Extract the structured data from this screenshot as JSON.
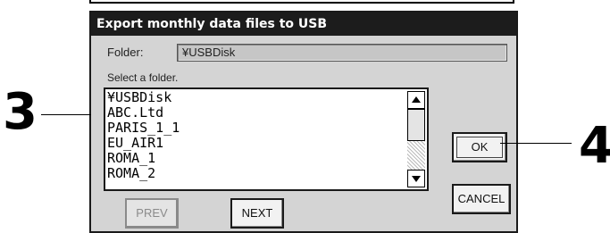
{
  "dialog": {
    "title": "Export monthly data files to USB",
    "folder_label": "Folder:",
    "folder_value": "¥USBDisk",
    "select_label": "Select a folder.",
    "folder_list": [
      "¥USBDisk",
      "ABC.Ltd",
      "PARIS_1_1",
      "EU_AIR1",
      "ROMA_1",
      "ROMA_2"
    ],
    "buttons": {
      "prev_label": "PREV",
      "next_label": "NEXT",
      "ok_label": "OK",
      "cancel_label": "CANCEL"
    }
  },
  "callouts": {
    "list_number": "3",
    "ok_number": "4"
  },
  "icons": {
    "scroll_up": "triangle-up-icon",
    "scroll_down": "triangle-down-icon"
  },
  "colors": {
    "title_bar": "#1c1c1c",
    "dialog_bg": "#d4d4d4",
    "disabled_text": "#8a8a8a"
  }
}
